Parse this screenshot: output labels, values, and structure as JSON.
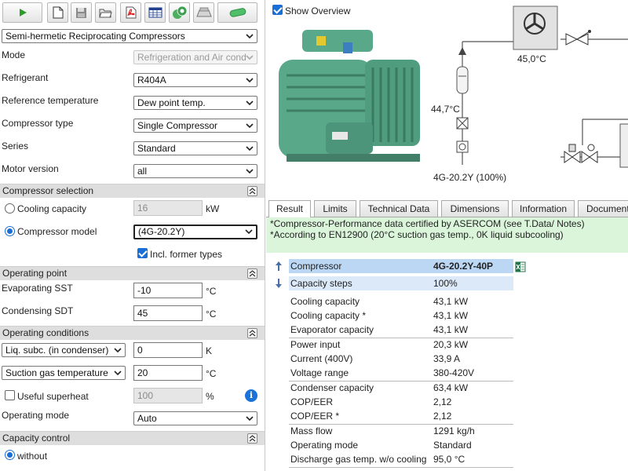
{
  "toolbar": {
    "icons": [
      "play-icon",
      "new-document-icon",
      "save-icon",
      "open-folder-icon",
      "pdf-icon",
      "table-icon",
      "compressor-series-icon",
      "condensing-unit-icon",
      "cylinder-icon"
    ]
  },
  "selection": {
    "product_line": "Semi-hermetic Reciprocating Compressors",
    "mode_label": "Mode",
    "mode_value": "Refrigeration and Air cond",
    "refrigerant_label": "Refrigerant",
    "refrigerant_value": "R404A",
    "reftemp_label": "Reference temperature",
    "reftemp_value": "Dew point temp.",
    "comptype_label": "Compressor type",
    "comptype_value": "Single Compressor",
    "series_label": "Series",
    "series_value": "Standard",
    "motor_label": "Motor version",
    "motor_value": "all"
  },
  "compressor_selection": {
    "title": "Compressor selection",
    "cooling_capacity_label": "Cooling capacity",
    "cooling_capacity_value": "16",
    "cooling_capacity_unit": "kW",
    "compressor_model_label": "Compressor model",
    "compressor_model_value": "(4G-20.2Y)",
    "former_types_label": "Incl. former types"
  },
  "operating_point": {
    "title": "Operating point",
    "evap_label": "Evaporating SST",
    "evap_value": "-10",
    "evap_unit": "°C",
    "cond_label": "Condensing SDT",
    "cond_value": "45",
    "cond_unit": "°C"
  },
  "operating_conditions": {
    "title": "Operating conditions",
    "liq_select": "Liq. subc. (in condenser)",
    "liq_value": "0",
    "liq_unit": "K",
    "suction_select": "Suction gas temperature",
    "suction_value": "20",
    "suction_unit": "°C",
    "superheat_label": "Useful superheat",
    "superheat_value": "100",
    "superheat_unit": "%",
    "opmode_label": "Operating mode",
    "opmode_value": "Auto"
  },
  "capacity_control": {
    "title": "Capacity control",
    "without_label": "without"
  },
  "overview": {
    "show_label": "Show Overview",
    "temp_condenser": "45,0°C",
    "temp_left": "44,7°C",
    "model_caption": "4G-20.2Y (100%)"
  },
  "tabs": [
    "Result",
    "Limits",
    "Technical Data",
    "Dimensions",
    "Information",
    "Document"
  ],
  "notes": {
    "line1": "*Compressor-Performance data certified by ASERCOM (see T.Data/ Notes)",
    "line2": "*According to EN12900 (20°C suction gas temp., 0K liquid subcooling)"
  },
  "results": {
    "compressor": {
      "k": "Compressor",
      "v": "4G-20.2Y-40P"
    },
    "steps": {
      "k": "Capacity steps",
      "v": "100%"
    },
    "rows": [
      {
        "k": "Cooling capacity",
        "v": "43,1 kW"
      },
      {
        "k": "Cooling capacity *",
        "v": "43,1 kW"
      },
      {
        "k": "Evaporator capacity",
        "v": "43,1 kW"
      },
      {
        "k": "Power input",
        "v": "20,3 kW"
      },
      {
        "k": "Current (400V)",
        "v": "33,9 A"
      },
      {
        "k": "Voltage range",
        "v": "380-420V"
      },
      {
        "k": "Condenser capacity",
        "v": "63,4 kW"
      },
      {
        "k": "COP/EER",
        "v": "2,12"
      },
      {
        "k": "COP/EER *",
        "v": "2,12"
      },
      {
        "k": "Mass flow",
        "v": "1291 kg/h"
      },
      {
        "k": "Operating mode",
        "v": "Standard"
      },
      {
        "k": "Discharge gas temp. w/o cooling",
        "v": "95,0 °C"
      }
    ]
  },
  "colors": {
    "accent": "#1a6fd6",
    "section_bg": "#dedede",
    "note_bg": "#dbf5db",
    "highlight": "#bcd7f3",
    "compressor_green": "#5aa88a"
  }
}
